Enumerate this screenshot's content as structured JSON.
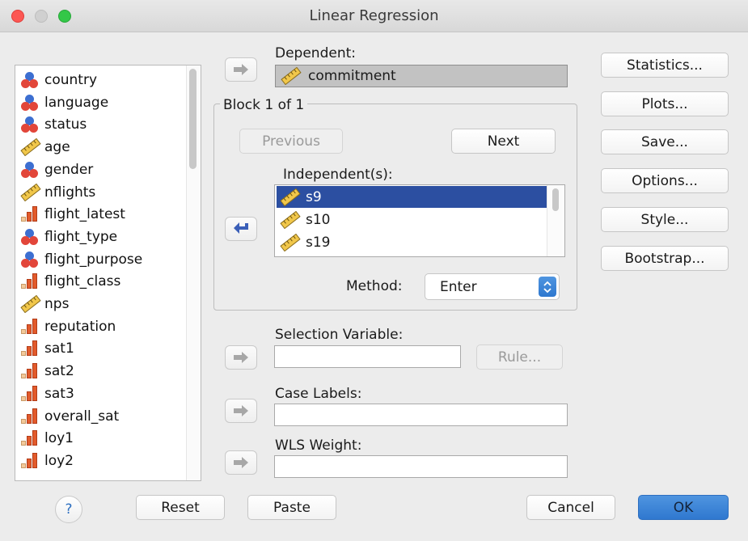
{
  "window": {
    "title": "Linear Regression"
  },
  "variables": [
    {
      "name": "country",
      "icon": "nominal-icon"
    },
    {
      "name": "language",
      "icon": "nominal-icon"
    },
    {
      "name": "status",
      "icon": "nominal-icon"
    },
    {
      "name": "age",
      "icon": "scale-icon"
    },
    {
      "name": "gender",
      "icon": "nominal-icon"
    },
    {
      "name": "nflights",
      "icon": "scale-icon"
    },
    {
      "name": "flight_latest",
      "icon": "ordinal-icon"
    },
    {
      "name": "flight_type",
      "icon": "nominal-icon"
    },
    {
      "name": "flight_purpose",
      "icon": "nominal-icon"
    },
    {
      "name": "flight_class",
      "icon": "ordinal-icon"
    },
    {
      "name": "nps",
      "icon": "scale-icon"
    },
    {
      "name": "reputation",
      "icon": "ordinal-icon"
    },
    {
      "name": "sat1",
      "icon": "ordinal-icon"
    },
    {
      "name": "sat2",
      "icon": "ordinal-icon"
    },
    {
      "name": "sat3",
      "icon": "ordinal-icon"
    },
    {
      "name": "overall_sat",
      "icon": "ordinal-icon"
    },
    {
      "name": "loy1",
      "icon": "ordinal-icon"
    },
    {
      "name": "loy2",
      "icon": "ordinal-icon"
    }
  ],
  "dependent": {
    "label": "Dependent:",
    "value": "commitment",
    "icon": "scale-icon"
  },
  "block": {
    "title": "Block 1 of 1",
    "previous_label": "Previous",
    "next_label": "Next",
    "independents_label": "Independent(s):",
    "independents": [
      {
        "name": "s9",
        "icon": "scale-icon",
        "selected": true
      },
      {
        "name": "s10",
        "icon": "scale-icon",
        "selected": false
      },
      {
        "name": "s19",
        "icon": "scale-icon",
        "selected": false
      }
    ],
    "method_label": "Method:",
    "method_value": "Enter"
  },
  "selection_variable": {
    "label": "Selection Variable:",
    "rule_label": "Rule..."
  },
  "case_labels": {
    "label": "Case Labels:"
  },
  "wls_weight": {
    "label": "WLS Weight:"
  },
  "side_buttons": {
    "statistics": "Statistics...",
    "plots": "Plots...",
    "save": "Save...",
    "options": "Options...",
    "style": "Style...",
    "bootstrap": "Bootstrap..."
  },
  "bottom_buttons": {
    "help": "?",
    "reset": "Reset",
    "paste": "Paste",
    "cancel": "Cancel",
    "ok": "OK"
  }
}
